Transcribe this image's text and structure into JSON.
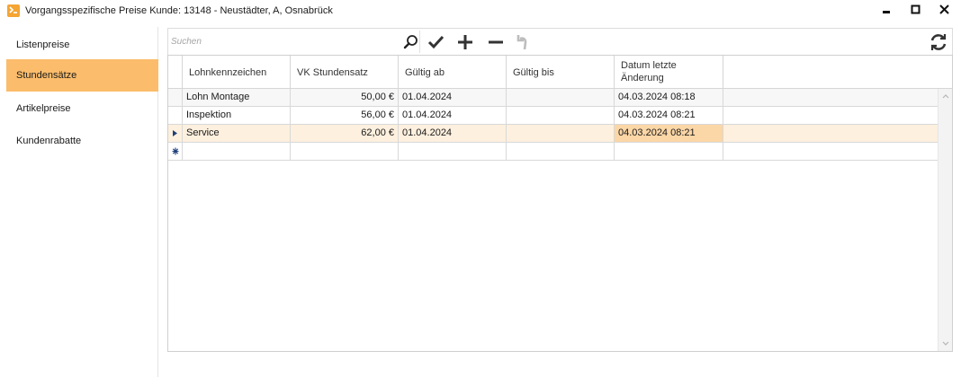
{
  "window": {
    "title": "Vorgangsspezifische Preise  Kunde: 13148 - Neustädter, A, Osnabrück"
  },
  "sidebar": {
    "items": [
      {
        "label": "Listenpreise",
        "active": false
      },
      {
        "label": "Stundensätze",
        "active": true
      },
      {
        "label": "Artikelpreise",
        "active": false
      },
      {
        "label": "Kundenrabatte",
        "active": false
      }
    ]
  },
  "toolbar": {
    "search_placeholder": "Suchen",
    "icons": [
      "search-icon",
      "checkmark-icon",
      "plus-icon",
      "minus-icon",
      "undo-icon",
      "refresh-icon"
    ]
  },
  "grid": {
    "columns": [
      "Lohnkennzeichen",
      "VK Stundensatz",
      "Gültig ab",
      "Gültig bis",
      "Datum letzte Änderung"
    ],
    "rows": [
      {
        "lohnkennzeichen": "Lohn Montage",
        "vk_stundensatz": "50,00 €",
        "gueltig_ab": "01.04.2024",
        "gueltig_bis": "",
        "datum_letzte_aenderung": "04.03.2024 08:18"
      },
      {
        "lohnkennzeichen": "Inspektion",
        "vk_stundensatz": "56,00 €",
        "gueltig_ab": "01.04.2024",
        "gueltig_bis": "",
        "datum_letzte_aenderung": "04.03.2024 08:21"
      },
      {
        "lohnkennzeichen": "Service",
        "vk_stundensatz": "62,00 €",
        "gueltig_ab": "01.04.2024",
        "gueltig_bis": "",
        "datum_letzte_aenderung": "04.03.2024 08:21"
      }
    ],
    "selected_row": 2
  },
  "colors": {
    "accent": "#fbbc6b",
    "selected_row": "#fdf0de",
    "selected_cell": "#fbd6a6",
    "indicator": "#1f3f7a"
  }
}
